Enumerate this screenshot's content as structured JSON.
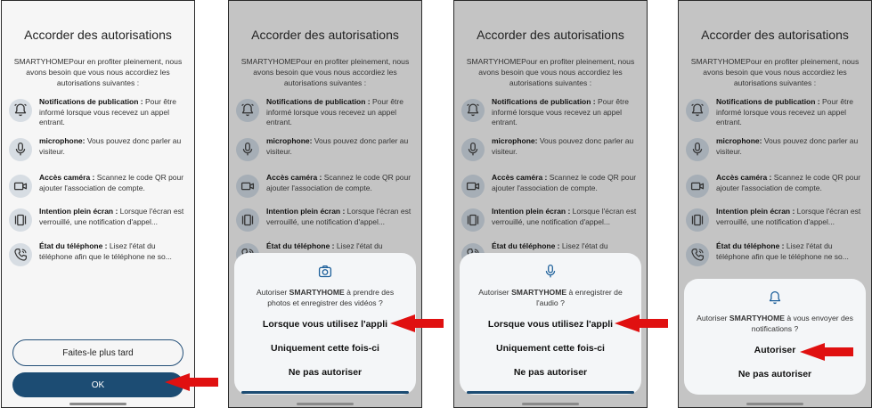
{
  "screen": {
    "title": "Accorder des autorisations",
    "intro": "SMARTYHOMEPour en profiter pleinement, nous avons besoin que vous nous accordiez les autorisations suivantes :",
    "permissions": [
      {
        "icon": "bell-icon",
        "name": "Notifications de publication :",
        "desc": " Pour être informé lorsque vous recevez un appel entrant."
      },
      {
        "icon": "microphone-icon",
        "name": "microphone:",
        "desc": " Vous pouvez donc parler au visiteur."
      },
      {
        "icon": "camera-icon",
        "name": "Accès caméra :",
        "desc": " Scannez le code QR pour ajouter l'association de compte."
      },
      {
        "icon": "fullscreen-icon",
        "name": "Intention plein écran :",
        "desc": " Lorsque l'écran est verrouillé, une notification d'appel..."
      },
      {
        "icon": "phone-icon",
        "name": "État du téléphone :",
        "desc": " Lisez l'état du téléphone afin que le téléphone ne so..."
      }
    ],
    "later_label": "Faites-le plus tard",
    "ok_label": "OK"
  },
  "dialogs": [
    {
      "icon": "camera-icon",
      "msg_pre": "Autoriser ",
      "app": "SMARTYHOME",
      "msg_post": " à prendre des photos et enregistrer des vidéos ?",
      "options": [
        "Lorsque vous utilisez l'appli",
        "Uniquement cette fois-ci",
        "Ne pas autoriser"
      ]
    },
    {
      "icon": "microphone-icon",
      "msg_pre": "Autoriser ",
      "app": "SMARTYHOME",
      "msg_post": " à enregistrer de l'audio ?",
      "options": [
        "Lorsque vous utilisez l'appli",
        "Uniquement cette fois-ci",
        "Ne pas autoriser"
      ]
    },
    {
      "icon": "bell-icon",
      "msg_pre": "Autoriser ",
      "app": "SMARTYHOME",
      "msg_post": " à vous envoyer des notifications ?",
      "options": [
        "Autoriser",
        "Ne pas autoriser"
      ]
    }
  ],
  "colors": {
    "primary": "#1c4c73",
    "arrow": "#e01010",
    "dim": "#c4c4c4"
  }
}
